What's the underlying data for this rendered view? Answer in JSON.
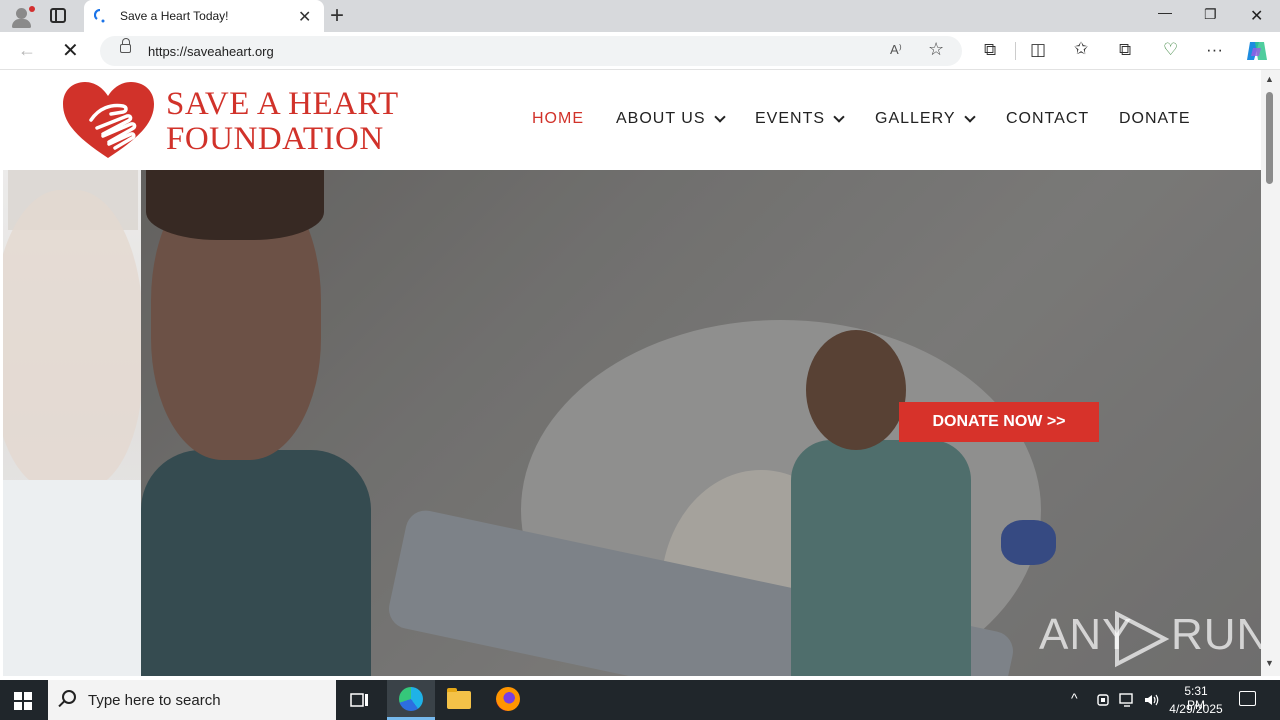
{
  "browser": {
    "tab_title": "Save a Heart Today!",
    "tab_close": "✕",
    "new_tab": "+",
    "url": "https://saveaheart.org",
    "read_aloud": "A⁾",
    "favorite_star": "☆",
    "window": {
      "minimize": "—",
      "maximize": "❐",
      "close": "✕"
    },
    "nav": {
      "back": "←",
      "stop": "✕"
    },
    "toolbar_icons": [
      "extensions-icon",
      "split-screen-icon",
      "favorites-icon",
      "collections-icon",
      "performance-icon",
      "more-icon",
      "copilot-icon"
    ],
    "toolbar_glyphs": {
      "extensions": "⧉",
      "split": "◫",
      "favorites": "✩",
      "collections": "⧉",
      "performance": "♡",
      "more": "···"
    }
  },
  "site": {
    "logo_line1": "SAVE A HEART",
    "logo_line2": "FOUNDATION",
    "brand_color": "#d1322a",
    "nav": [
      {
        "label": "HOME",
        "active": true,
        "dropdown": false
      },
      {
        "label": "ABOUT US",
        "active": false,
        "dropdown": true
      },
      {
        "label": "EVENTS",
        "active": false,
        "dropdown": true
      },
      {
        "label": "GALLERY",
        "active": false,
        "dropdown": true
      },
      {
        "label": "CONTACT",
        "active": false,
        "dropdown": false
      },
      {
        "label": "DONATE",
        "active": false,
        "dropdown": false
      }
    ],
    "hero_cta": "DONATE NOW >>",
    "watermark_left": "ANY",
    "watermark_right": "RUN"
  },
  "scrollbar": {
    "up": "▲",
    "down": "▼"
  },
  "taskbar": {
    "search_placeholder": "Type here to search",
    "apps": [
      "task-view",
      "edge",
      "file-explorer",
      "firefox"
    ],
    "tray": {
      "chevron": "^",
      "time": "5:31 PM",
      "date": "4/29/2025"
    }
  }
}
